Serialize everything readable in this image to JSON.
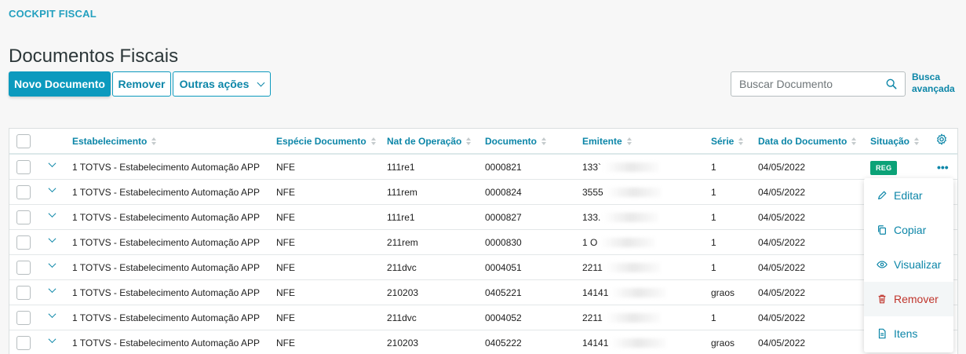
{
  "breadcrumb": "COCKPIT FISCAL",
  "title": "Documentos Fiscais",
  "toolbar": {
    "new_label": "Novo Documento",
    "remove_label": "Remover",
    "more_label": "Outras ações"
  },
  "search": {
    "placeholder": "Buscar Documento",
    "advanced_line1": "Busca",
    "advanced_line2": "avançada"
  },
  "table": {
    "headers": {
      "estabelecimento": "Estabelecimento",
      "especie": "Espécie Documento",
      "nat": "Nat de Operação",
      "documento": "Documento",
      "emitente": "Emitente",
      "serie": "Série",
      "data": "Data do Documento",
      "situacao": "Situação"
    },
    "rows": [
      {
        "estabelecimento": "1 TOTVS - Estabelecimento Automação APP",
        "especie": "NFE",
        "nat": "111re1",
        "documento": "0000821",
        "emitente": "133`",
        "serie": "1",
        "data": "04/05/2022",
        "situacao": "REG"
      },
      {
        "estabelecimento": "1 TOTVS - Estabelecimento Automação APP",
        "especie": "NFE",
        "nat": "111rem",
        "documento": "0000824",
        "emitente": "3555",
        "serie": "1",
        "data": "04/05/2022",
        "situacao": ""
      },
      {
        "estabelecimento": "1 TOTVS - Estabelecimento Automação APP",
        "especie": "NFE",
        "nat": "111re1",
        "documento": "0000827",
        "emitente": "133.",
        "serie": "1",
        "data": "04/05/2022",
        "situacao": ""
      },
      {
        "estabelecimento": "1 TOTVS - Estabelecimento Automação APP",
        "especie": "NFE",
        "nat": "211rem",
        "documento": "0000830",
        "emitente": "1 O",
        "serie": "1",
        "data": "04/05/2022",
        "situacao": ""
      },
      {
        "estabelecimento": "1 TOTVS - Estabelecimento Automação APP",
        "especie": "NFE",
        "nat": "211dvc",
        "documento": "0004051",
        "emitente": "2211",
        "serie": "1",
        "data": "04/05/2022",
        "situacao": ""
      },
      {
        "estabelecimento": "1 TOTVS - Estabelecimento Automação APP",
        "especie": "NFE",
        "nat": "210203",
        "documento": "0405221",
        "emitente": "14141",
        "serie": "graos",
        "data": "04/05/2022",
        "situacao": ""
      },
      {
        "estabelecimento": "1 TOTVS - Estabelecimento Automação APP",
        "especie": "NFE",
        "nat": "211dvc",
        "documento": "0004052",
        "emitente": "2211",
        "serie": "1",
        "data": "04/05/2022",
        "situacao": ""
      },
      {
        "estabelecimento": "1 TOTVS - Estabelecimento Automação APP",
        "especie": "NFE",
        "nat": "210203",
        "documento": "0405222",
        "emitente": "14141",
        "serie": "graos",
        "data": "04/05/2022",
        "situacao": ""
      }
    ]
  },
  "actions_menu": {
    "edit": "Editar",
    "copy": "Copiar",
    "view": "Visualizar",
    "remove": "Remover",
    "items": "Itens"
  },
  "colors": {
    "primary": "#0c9abe",
    "link": "#0c86a8",
    "badge": "#0ba277",
    "danger": "#c0352c"
  }
}
